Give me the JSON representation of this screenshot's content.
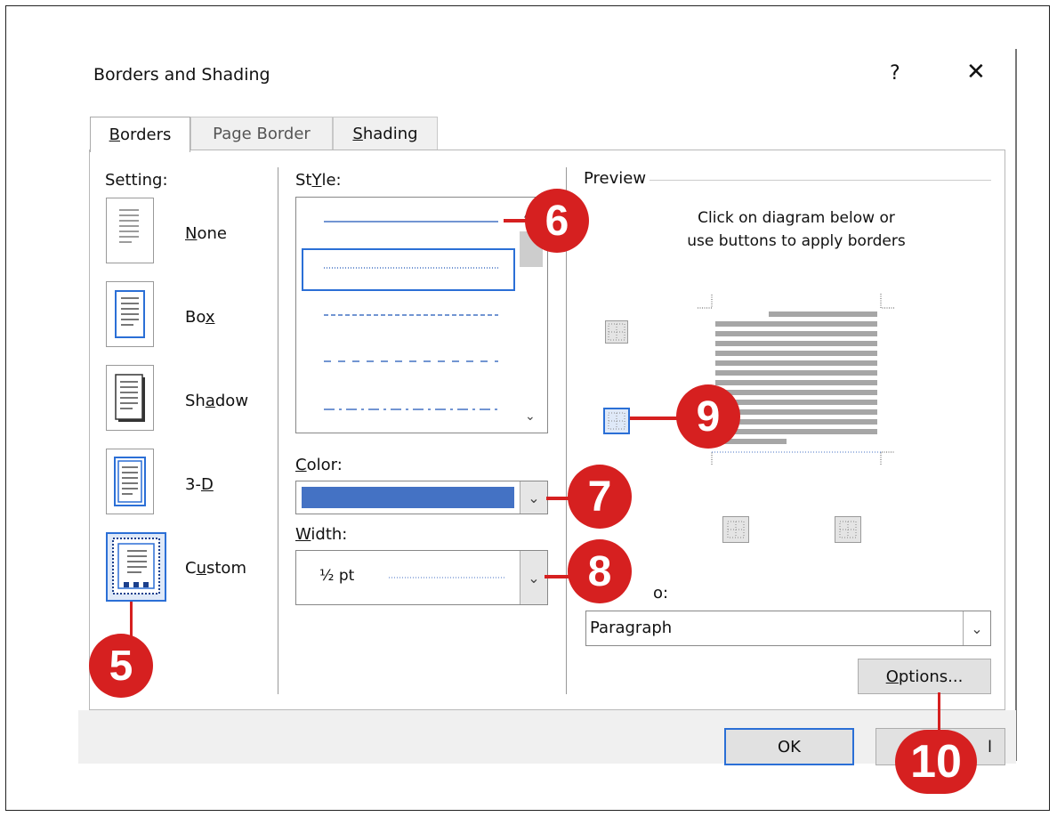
{
  "dialog": {
    "title": "Borders and Shading",
    "help": "?",
    "close": "✕"
  },
  "tabs": [
    {
      "label": "Borders",
      "underline": "B",
      "rest": "orders",
      "active": true
    },
    {
      "label": "Page Border",
      "active": false
    },
    {
      "label": "Shading",
      "underline": "S",
      "rest": "hading",
      "active": false
    }
  ],
  "setting": {
    "label": "Setting:",
    "items": [
      {
        "pre": "",
        "ul": "N",
        "post": "one"
      },
      {
        "pre": "Bo",
        "ul": "x",
        "post": ""
      },
      {
        "pre": "Sh",
        "ul": "a",
        "post": "dow"
      },
      {
        "pre": "3-",
        "ul": "D",
        "post": ""
      },
      {
        "pre": "C",
        "ul": "u",
        "post": "stom"
      }
    ]
  },
  "style": {
    "label_ul": "Y",
    "label": "St",
    "label_rest": "le:",
    "lines": [
      "solid",
      "dotted",
      "dashed-fine",
      "dashed",
      "dash-dot"
    ],
    "selected_index": 1
  },
  "color": {
    "label_ul": "C",
    "label_rest": "olor:",
    "value_hex": "#4472c4"
  },
  "width": {
    "label_ul": "W",
    "label_rest": "idth:",
    "value": "½ pt"
  },
  "preview": {
    "label": "Preview",
    "instruction_line1": "Click on diagram below or",
    "instruction_line2": "use buttons to apply borders"
  },
  "apply_to": {
    "label_visible": "o:",
    "value": "Paragraph"
  },
  "buttons": {
    "options_ul": "O",
    "options_rest": "ptions...",
    "ok": "OK",
    "cancel_partial": "l"
  },
  "callouts": [
    "5",
    "6",
    "7",
    "8",
    "9",
    "10"
  ],
  "colors": {
    "callout": "#d62020",
    "accent": "#2b6fd6",
    "line": "#4472c4"
  }
}
